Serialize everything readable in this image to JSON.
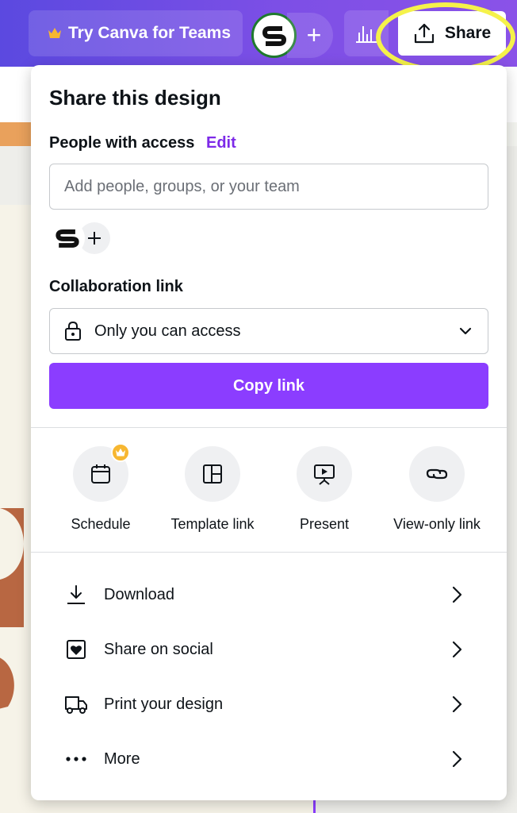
{
  "topbar": {
    "teams_label": "Try Canva for Teams",
    "avatar_initial": "S",
    "add_label": "+",
    "share_label": "Share"
  },
  "panel": {
    "title": "Share this design",
    "people_label": "People with access",
    "edit_label": "Edit",
    "people_placeholder": "Add people, groups, or your team",
    "collab_label": "Collaboration link",
    "access_value": "Only you can access",
    "copy_label": "Copy link",
    "options": [
      {
        "label": "Schedule",
        "icon": "calendar-icon",
        "premium": true
      },
      {
        "label": "Template link",
        "icon": "template-icon",
        "premium": false
      },
      {
        "label": "Present",
        "icon": "present-icon",
        "premium": false
      },
      {
        "label": "View-only link",
        "icon": "link-icon",
        "premium": false
      }
    ],
    "actions": [
      {
        "label": "Download",
        "icon": "download-icon"
      },
      {
        "label": "Share on social",
        "icon": "heart-icon"
      },
      {
        "label": "Print your design",
        "icon": "truck-icon"
      },
      {
        "label": "More",
        "icon": "more-icon"
      }
    ]
  },
  "colors": {
    "accent": "#8b3dff",
    "edit_link": "#7d2ae8",
    "highlight": "#f5f24a",
    "premium_badge": "#f7b731"
  }
}
